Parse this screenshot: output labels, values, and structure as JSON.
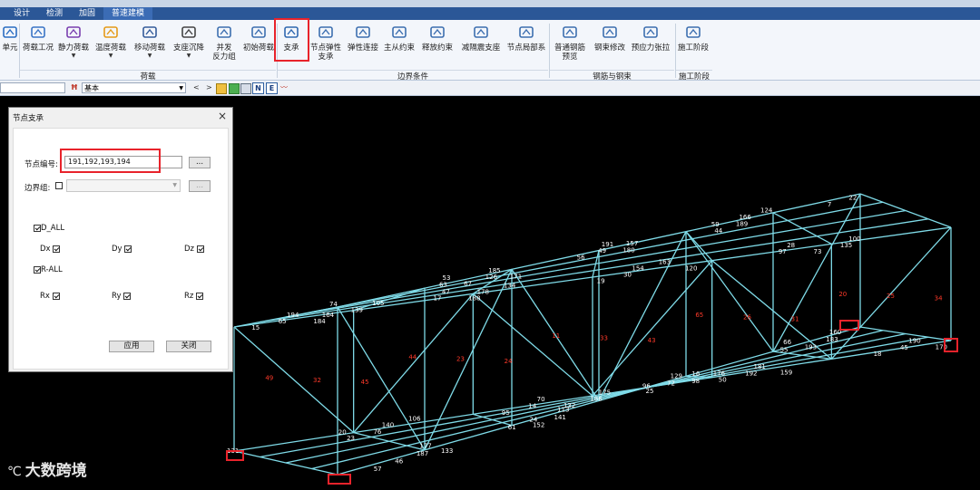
{
  "menubar": {
    "items": [
      "设计",
      "检测",
      "加固",
      "普速建模"
    ]
  },
  "ribbon": {
    "buttons": [
      {
        "label": "单元",
        "icon": "element-icon",
        "arrow": false
      },
      {
        "label": "荷载工况",
        "icon": "load-case-icon",
        "arrow": false
      },
      {
        "label": "静力荷载",
        "icon": "static-load-icon",
        "arrow": true
      },
      {
        "label": "温度荷载",
        "icon": "temperature-load-icon",
        "arrow": true
      },
      {
        "label": "移动荷载",
        "icon": "moving-load-icon",
        "arrow": true
      },
      {
        "label": "支座沉降",
        "icon": "support-settlement-icon",
        "arrow": true
      },
      {
        "label": "并发\n反力组",
        "icon": "concurrent-reaction-icon",
        "arrow": false
      },
      {
        "label": "初始荷载",
        "icon": "initial-load-icon",
        "arrow": false
      },
      {
        "label": "支承",
        "icon": "support-icon",
        "arrow": false
      },
      {
        "label": "节点弹性\n支承",
        "icon": "nodal-spring-icon",
        "arrow": false
      },
      {
        "label": "弹性连接",
        "icon": "elastic-link-icon",
        "arrow": false
      },
      {
        "label": "主从约束",
        "icon": "master-slave-icon",
        "arrow": false
      },
      {
        "label": "释放约束",
        "icon": "release-icon",
        "arrow": false
      },
      {
        "label": "减隔震支座",
        "icon": "isolation-bearing-icon",
        "arrow": false
      },
      {
        "label": "节点局部系",
        "icon": "node-local-axis-icon",
        "arrow": false
      },
      {
        "label": "普通钢筋\n预览",
        "icon": "rebar-preview-icon",
        "arrow": false
      },
      {
        "label": "钢束修改",
        "icon": "tendon-edit-icon",
        "arrow": false
      },
      {
        "label": "预应力张拉",
        "icon": "prestress-icon",
        "arrow": false
      },
      {
        "label": "施工阶段",
        "icon": "construction-stage-icon",
        "arrow": false
      }
    ],
    "groups": [
      "荷载",
      "边界条件",
      "钢筋与钢束",
      "施工阶段"
    ]
  },
  "toolbar2": {
    "combo_value": "基本",
    "nav_prev": "<",
    "nav_next": ">",
    "toggle_n": "N",
    "toggle_e": "E"
  },
  "dialog": {
    "title": "节点支承",
    "close": "×",
    "node_label": "节点编号:",
    "node_value": "191,192,193,194",
    "browse": "...",
    "group_label": "边界组:",
    "group_browse": "...",
    "d_all": "D_ALL",
    "dx": "Dx",
    "dy": "Dy",
    "dz": "Dz",
    "r_all": "R-ALL",
    "rx": "Rx",
    "ry": "Ry",
    "rz": "Rz",
    "apply": "应用",
    "close_btn": "关闭"
  },
  "model": {
    "line_color": "#7fdbe8",
    "label_color": "#ff3a2a",
    "node_label_color": "#ffffff",
    "node_labels": [
      "21",
      "63",
      "95",
      "96",
      "97",
      "7",
      "20",
      "61",
      "19",
      "59",
      "18",
      "57",
      "17",
      "56",
      "16",
      "55",
      "15",
      "53",
      "14",
      "25",
      "28",
      "22",
      "23",
      "24",
      "30",
      "44",
      "45",
      "46",
      "47",
      "49",
      "50",
      "66",
      "65",
      "67",
      "70",
      "72",
      "73",
      "74",
      "76",
      "152",
      "154",
      "189",
      "190",
      "187",
      "188",
      "191",
      "192",
      "193",
      "194",
      "126",
      "132",
      "129",
      "135",
      "139",
      "140",
      "141",
      "163",
      "166",
      "170",
      "177",
      "178",
      "180",
      "181",
      "183",
      "184",
      "185",
      "186",
      "98",
      "100",
      "105",
      "106",
      "113",
      "120",
      "124",
      "131",
      "133",
      "134",
      "157",
      "159",
      "160",
      "164",
      "171",
      "175",
      "176"
    ],
    "element_labels": [
      "49",
      "32",
      "45",
      "44",
      "23",
      "24",
      "11",
      "33",
      "43",
      "65",
      "26",
      "31",
      "20",
      "25",
      "34"
    ]
  },
  "watermark": {
    "text": "大数跨境"
  }
}
